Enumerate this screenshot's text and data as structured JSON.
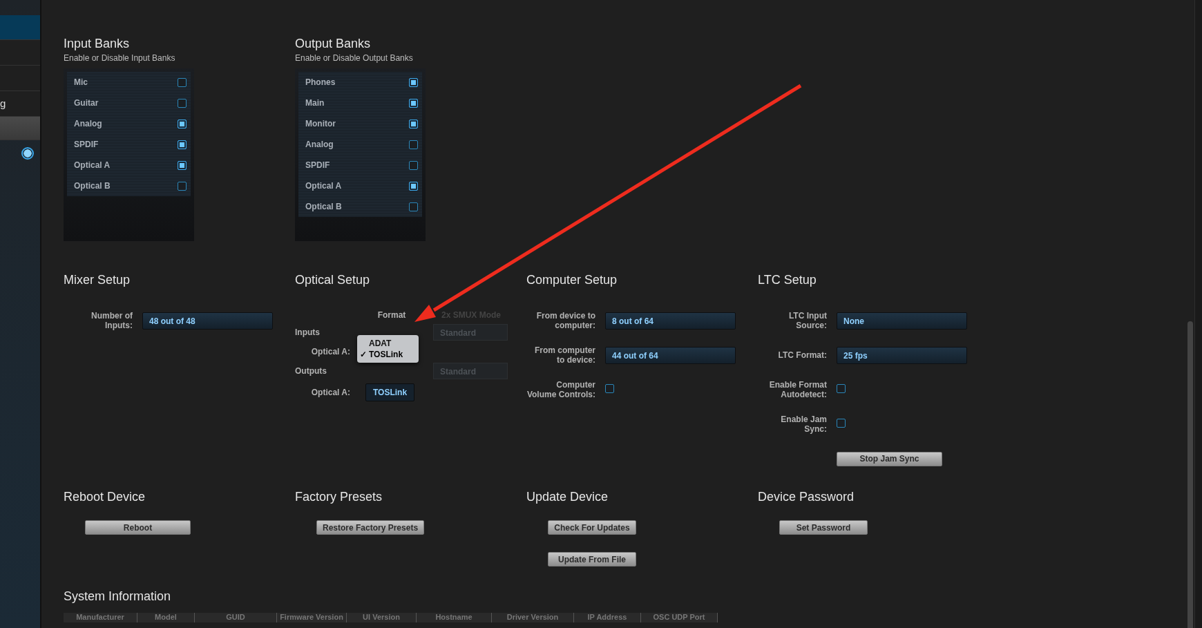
{
  "sidebar": {
    "items": [
      {
        "selected": true
      },
      {
        "selected": false
      },
      {
        "selected": false
      },
      {
        "label": "g",
        "selected": false
      },
      {
        "selected": false,
        "kind": "group"
      }
    ],
    "toggle": {
      "on": true
    }
  },
  "input_banks": {
    "title": "Input Banks",
    "subtitle": "Enable or Disable Input Banks",
    "items": [
      {
        "label": "Mic",
        "checked": false
      },
      {
        "label": "Guitar",
        "checked": false
      },
      {
        "label": "Analog",
        "checked": true
      },
      {
        "label": "SPDIF",
        "checked": true
      },
      {
        "label": "Optical A",
        "checked": true
      },
      {
        "label": "Optical B",
        "checked": false
      }
    ]
  },
  "output_banks": {
    "title": "Output Banks",
    "subtitle": "Enable or Disable Output Banks",
    "items": [
      {
        "label": "Phones",
        "checked": true
      },
      {
        "label": "Main",
        "checked": true
      },
      {
        "label": "Monitor",
        "checked": true
      },
      {
        "label": "Analog",
        "checked": false
      },
      {
        "label": "SPDIF",
        "checked": false
      },
      {
        "label": "Optical A",
        "checked": true
      },
      {
        "label": "Optical B",
        "checked": false
      }
    ]
  },
  "mixer_setup": {
    "title": "Mixer Setup",
    "rows": [
      {
        "kind": "select",
        "label": "Number of Inputs:",
        "value": "48 out of 48"
      }
    ]
  },
  "optical_setup": {
    "title": "Optical Setup",
    "format_header": "Format",
    "smux_header": "2x SMUX Mode",
    "inputs_label": "Inputs",
    "outputs_label": "Outputs",
    "input_row": {
      "label": "Optical A:",
      "smux": "Standard",
      "popup": {
        "check_glyph": "✓",
        "options": [
          {
            "label": "ADAT",
            "selected": false
          },
          {
            "label": "TOSLink",
            "selected": true
          }
        ]
      }
    },
    "output_row": {
      "label": "Optical A:",
      "format": "TOSLink",
      "smux": "Standard"
    }
  },
  "computer_setup": {
    "title": "Computer Setup",
    "rows": [
      {
        "kind": "select",
        "label": "From device to computer:",
        "value": "8 out of 64"
      },
      {
        "kind": "select",
        "label": "From computer to device:",
        "value": "44 out of 64"
      },
      {
        "kind": "checkbox",
        "label": "Computer Volume Controls:",
        "checked": false
      }
    ]
  },
  "ltc_setup": {
    "title": "LTC Setup",
    "rows": [
      {
        "kind": "select",
        "label": "LTC Input Source:",
        "value": "None"
      },
      {
        "kind": "select",
        "label": "LTC Format:",
        "value": "25 fps"
      },
      {
        "kind": "checkbox",
        "label": "Enable Format Autodetect:",
        "checked": false
      },
      {
        "kind": "checkbox",
        "label": "Enable Jam Sync:",
        "checked": false
      },
      {
        "kind": "button",
        "label": "Stop Jam Sync"
      }
    ]
  },
  "actions": [
    {
      "title": "Reboot Device",
      "buttons": [
        "Reboot"
      ]
    },
    {
      "title": "Factory Presets",
      "buttons": [
        "Restore Factory Presets"
      ]
    },
    {
      "title": "Update Device",
      "buttons": [
        "Check For Updates",
        "Update From File"
      ]
    },
    {
      "title": "Device Password",
      "buttons": [
        "Set Password"
      ]
    }
  ],
  "system_information": {
    "title": "System Information",
    "columns": [
      "Manufacturer",
      "Model",
      "GUID",
      "Firmware Version",
      "UI Version",
      "Hostname",
      "Driver Version",
      "IP Address",
      "OSC UDP Port"
    ]
  },
  "annotation": {
    "kind": "arrow",
    "color": "#ee2c1e"
  }
}
